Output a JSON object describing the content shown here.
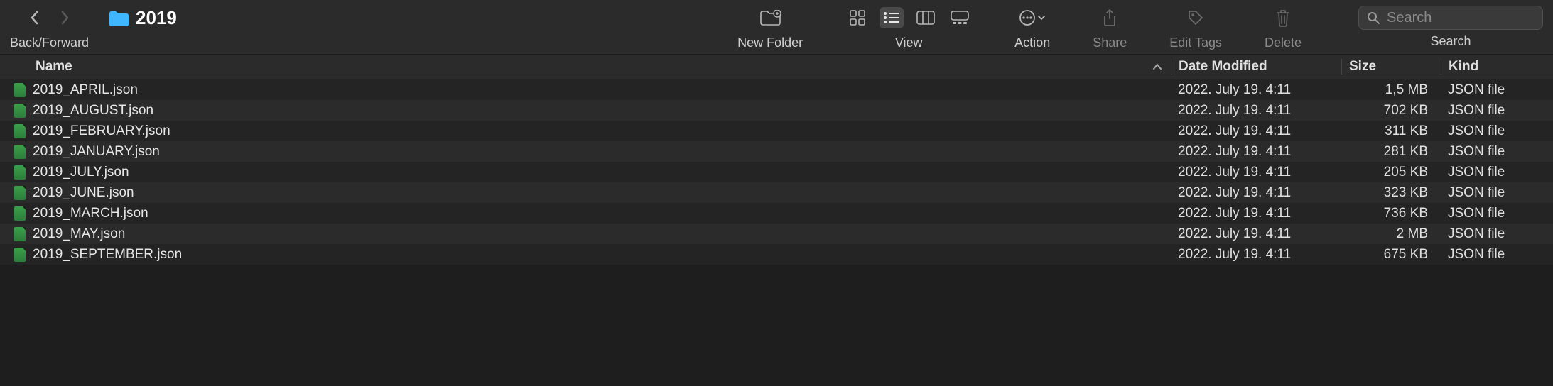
{
  "nav": {
    "label": "Back/Forward"
  },
  "folder": {
    "name": "2019"
  },
  "toolbar": {
    "new_folder": "New Folder",
    "view": "View",
    "action": "Action",
    "share": "Share",
    "edit_tags": "Edit Tags",
    "delete": "Delete",
    "search": "Search",
    "search_placeholder": "Search"
  },
  "columns": {
    "name": "Name",
    "date": "Date Modified",
    "size": "Size",
    "kind": "Kind"
  },
  "files": [
    {
      "name": "2019_APRIL.json",
      "date": "2022. July 19. 4:11",
      "size": "1,5 MB",
      "kind": "JSON file"
    },
    {
      "name": "2019_AUGUST.json",
      "date": "2022. July 19. 4:11",
      "size": "702 KB",
      "kind": "JSON file"
    },
    {
      "name": "2019_FEBRUARY.json",
      "date": "2022. July 19. 4:11",
      "size": "311 KB",
      "kind": "JSON file"
    },
    {
      "name": "2019_JANUARY.json",
      "date": "2022. July 19. 4:11",
      "size": "281 KB",
      "kind": "JSON file"
    },
    {
      "name": "2019_JULY.json",
      "date": "2022. July 19. 4:11",
      "size": "205 KB",
      "kind": "JSON file"
    },
    {
      "name": "2019_JUNE.json",
      "date": "2022. July 19. 4:11",
      "size": "323 KB",
      "kind": "JSON file"
    },
    {
      "name": "2019_MARCH.json",
      "date": "2022. July 19. 4:11",
      "size": "736 KB",
      "kind": "JSON file"
    },
    {
      "name": "2019_MAY.json",
      "date": "2022. July 19. 4:11",
      "size": "2 MB",
      "kind": "JSON file"
    },
    {
      "name": "2019_SEPTEMBER.json",
      "date": "2022. July 19. 4:11",
      "size": "675 KB",
      "kind": "JSON file"
    }
  ]
}
